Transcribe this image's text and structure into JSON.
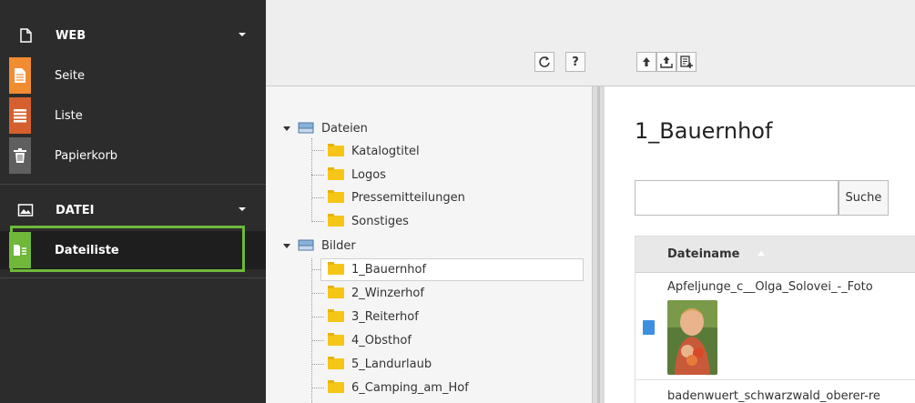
{
  "sidebar": {
    "web_label": "WEB",
    "web_items": [
      {
        "label": "Seite",
        "icon": "page-icon",
        "color": "#f18c31"
      },
      {
        "label": "Liste",
        "icon": "list-icon",
        "color": "#d5602e"
      },
      {
        "label": "Papierkorb",
        "icon": "trash-icon",
        "color": "#5f5f5f"
      }
    ],
    "datei_label": "DATEI",
    "datei_items": [
      {
        "label": "Dateiliste",
        "icon": "filelist-icon",
        "color": "#6fb83a"
      }
    ]
  },
  "toolbar": {
    "refresh_icon": "refresh-icon",
    "help_label": "?",
    "icons": [
      "upload-icon",
      "upload-tray-icon",
      "new-file-icon"
    ]
  },
  "tree": {
    "storage1": "Dateien",
    "storage1_children": [
      "Katalogtitel",
      "Logos",
      "Pressemitteilungen",
      "Sonstiges"
    ],
    "storage2": "Bilder",
    "storage2_children": [
      "1_Bauernhof",
      "2_Winzerhof",
      "3_Reiterhof",
      "4_Obsthof",
      "5_Landurlaub",
      "6_Camping_am_Hof"
    ],
    "selected": "1_Bauernhof"
  },
  "main": {
    "title": "1_Bauernhof",
    "search_button": "Suche",
    "search_placeholder": "",
    "column_header": "Dateiname",
    "files": [
      "Apfeljunge_c__Olga_Solovei_-_Foto",
      "badenwuert_schwarzwald_oberer-re"
    ]
  },
  "colors": {
    "sidebar_bg": "#2c2c2c",
    "highlight": "#6fb83a",
    "folder": "#f5c518"
  }
}
